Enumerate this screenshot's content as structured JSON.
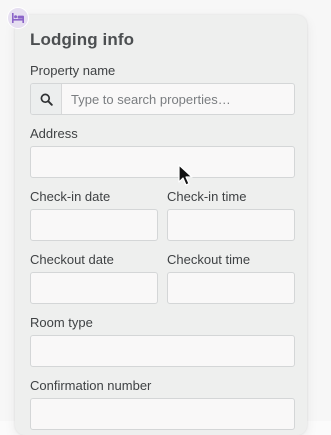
{
  "card": {
    "title": "Lodging info",
    "icon": "bed-icon"
  },
  "fields": {
    "property_name": {
      "label": "Property name",
      "placeholder": "Type to search properties…",
      "value": ""
    },
    "address": {
      "label": "Address",
      "value": ""
    },
    "checkin_date": {
      "label": "Check-in date",
      "value": ""
    },
    "checkin_time": {
      "label": "Check-in time",
      "value": ""
    },
    "checkout_date": {
      "label": "Checkout date",
      "value": ""
    },
    "checkout_time": {
      "label": "Checkout time",
      "value": ""
    },
    "room_type": {
      "label": "Room type",
      "value": ""
    },
    "confirmation_number": {
      "label": "Confirmation number",
      "value": ""
    }
  },
  "colors": {
    "accent": "#8a63c8",
    "card_bg": "#eeefee",
    "input_bg": "#f9f8f8"
  }
}
